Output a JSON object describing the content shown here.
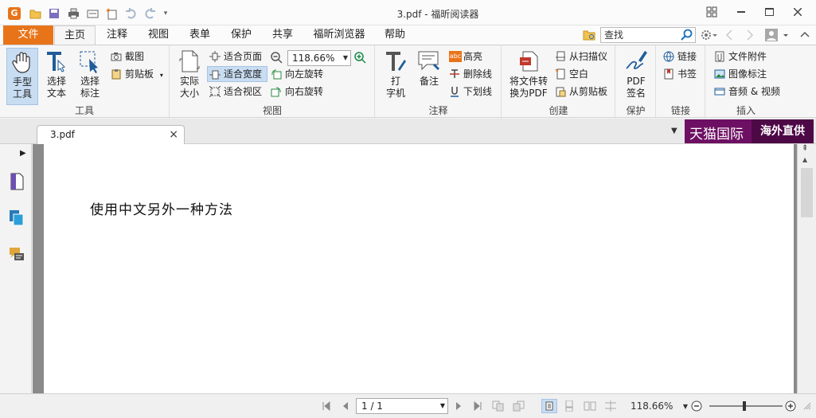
{
  "window": {
    "title": "3.pdf - 福昕阅读器",
    "app_logo": "G"
  },
  "menu": {
    "file": "文件",
    "tabs": [
      "主页",
      "注释",
      "视图",
      "表单",
      "保护",
      "共享",
      "福昕浏览器",
      "帮助"
    ],
    "active_tab": "主页",
    "search_placeholder": "查找"
  },
  "ribbon": {
    "tools": {
      "label": "工具",
      "hand": "手型\n工具",
      "select_text": "选择\n文本",
      "select_annot": "选择\n标注",
      "screenshot": "截图",
      "clipboard": "剪贴板"
    },
    "view": {
      "label": "视图",
      "actual_size": "实际\n大小",
      "fit_page": "适合页面",
      "fit_width": "适合宽度",
      "fit_visible": "适合视区",
      "zoom_value": "118.66%",
      "rotate_left": "向左旋转",
      "rotate_right": "向右旋转"
    },
    "annotation": {
      "label": "注释",
      "typewriter": "打\n字机",
      "note": "备注",
      "highlight": "高亮",
      "strikeout": "删除线",
      "underline": "下划线",
      "abc_badge": "abc"
    },
    "create": {
      "label": "创建",
      "convert_pdf": "将文件转\n换为PDF",
      "from_scanner": "从扫描仪",
      "blank": "空白",
      "from_clipboard": "从剪贴板"
    },
    "protect": {
      "label": "保护",
      "pdf_sign": "PDF\n签名"
    },
    "links": {
      "label": "链接",
      "link": "链接",
      "bookmark": "书签"
    },
    "insert": {
      "label": "插入",
      "file_attachment": "文件附件",
      "image_annot": "图像标注",
      "audio_video": "音频 & 视频"
    }
  },
  "document_tab": {
    "name": "3.pdf",
    "close": "×"
  },
  "ad": {
    "left": "天猫国际",
    "right": "海外直供"
  },
  "page": {
    "text": "使用中文另外一种方法"
  },
  "status": {
    "page": "1 / 1",
    "zoom": "118.66%"
  },
  "colors": {
    "accent": "#e8741a",
    "selection": "#c8ddf2",
    "ad_bg": "#6d0f63"
  }
}
